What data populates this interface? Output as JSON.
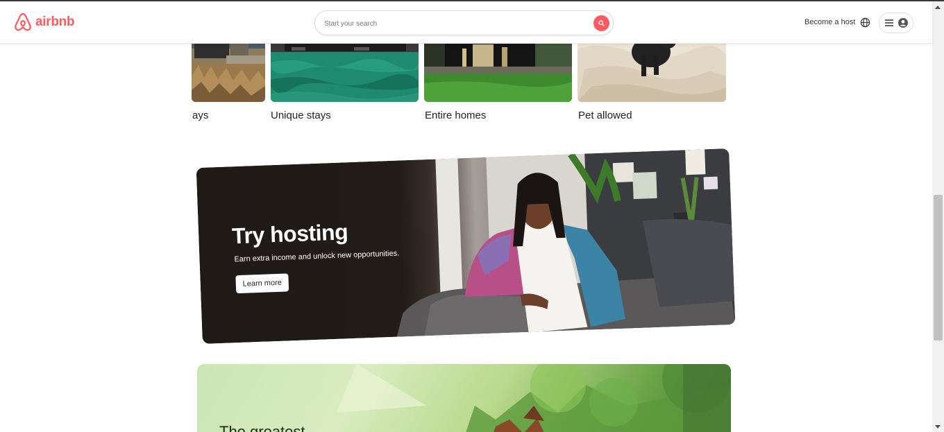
{
  "header": {
    "logo_text": "airbnb",
    "search_placeholder": "Start your search",
    "become_host": "Become a host"
  },
  "categories": [
    {
      "label": "ays",
      "image": "countryside-house-with-tall-grass"
    },
    {
      "label": "Unique stays",
      "image": "houseboat-on-green-water"
    },
    {
      "label": "Entire homes",
      "image": "black-cabin-with-lawn"
    },
    {
      "label": "Pet allowed",
      "image": "black-cat-on-bed"
    }
  ],
  "hosting_banner": {
    "title": "Try hosting",
    "subtitle": "Earn extra income and unlock new opportunities.",
    "button": "Learn more",
    "image": "woman-seated-on-sofa-in-living-room"
  },
  "next_banner": {
    "title": "The greatest",
    "image": "green-forest-illustration-with-house"
  },
  "colors": {
    "brand": "#FF5A5F",
    "banner_dark": "#201A17"
  }
}
